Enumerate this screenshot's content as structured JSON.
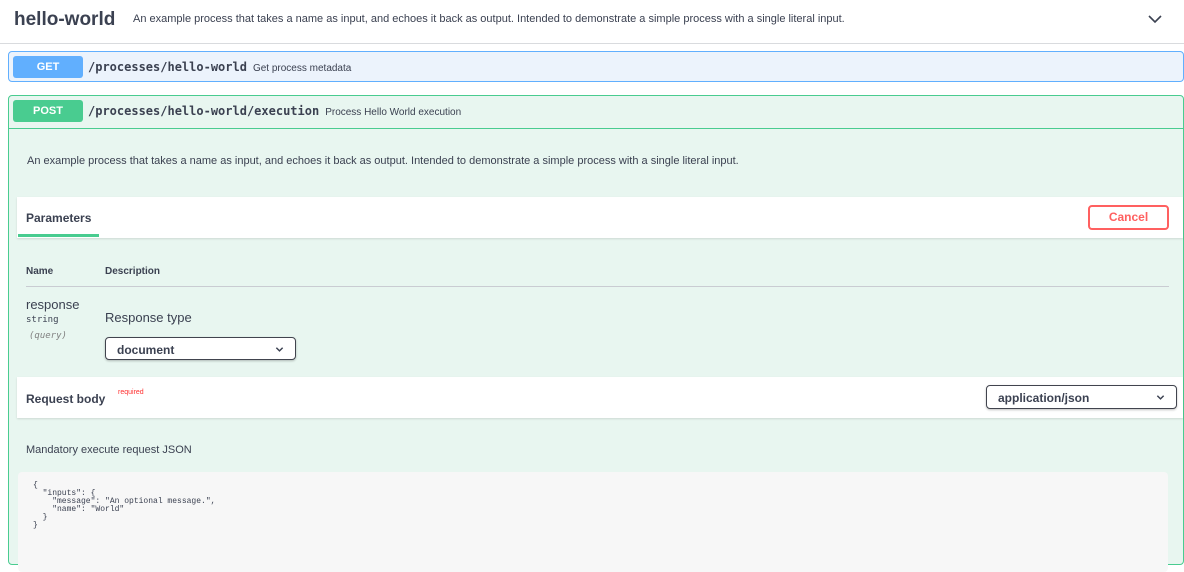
{
  "tag": {
    "name": "hello-world",
    "description": "An example process that takes a name as input, and echoes it back as output. Intended to demonstrate a simple process with a single literal input.",
    "chevron_icon": "chevron-down-icon"
  },
  "get_op": {
    "method": "GET",
    "path": "/processes/hello-world",
    "summary": "Get process metadata",
    "color": "#61affe"
  },
  "post_op": {
    "method": "POST",
    "path": "/processes/hello-world/execution",
    "summary": "Process Hello World execution",
    "description": "An example process that takes a name as input, and echoes it back as output. Intended to demonstrate a simple process with a single literal input.",
    "color": "#49cc90",
    "parameters": {
      "title": "Parameters",
      "cancel_label": "Cancel",
      "col_name": "Name",
      "col_description": "Description",
      "items": [
        {
          "name": "response",
          "type": "string",
          "in": "(query)",
          "description": "Response type",
          "selected": "document"
        }
      ]
    },
    "request_body": {
      "title": "Request body",
      "required_label": "required",
      "content_type": "application/json",
      "description": "Mandatory execute request JSON",
      "example": "{\n  \"inputs\": {\n    \"message\": \"An optional message.\",\n    \"name\": \"World\"\n  }\n}"
    }
  },
  "colors": {
    "cancel": "#ff6060",
    "required": "#ff2f2f"
  }
}
